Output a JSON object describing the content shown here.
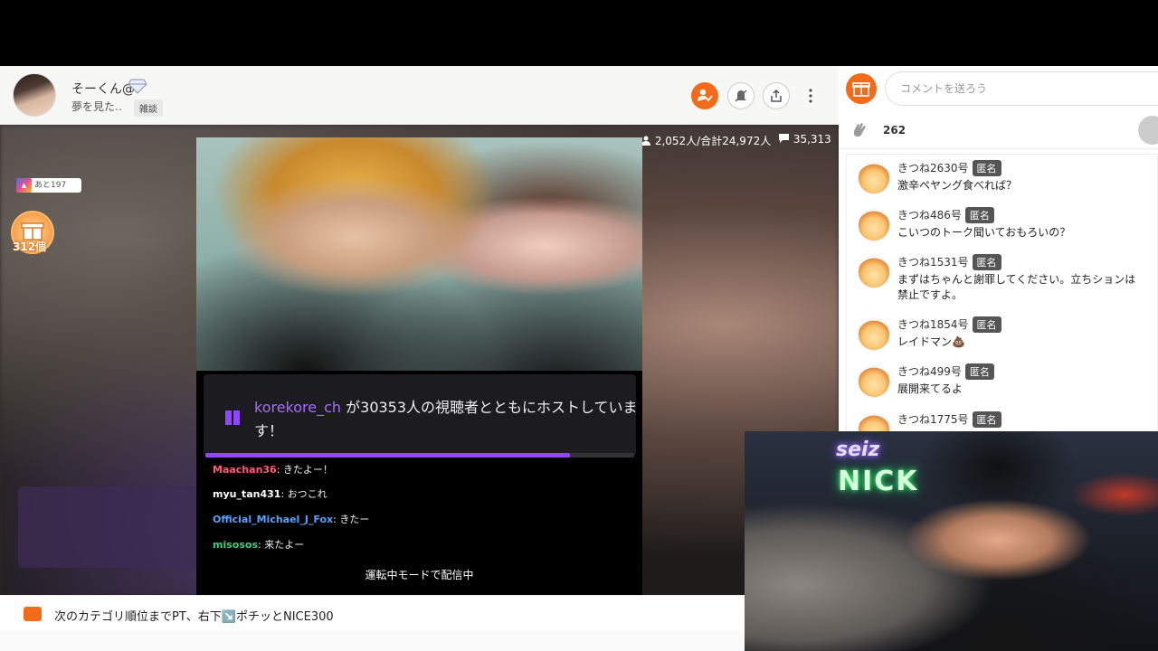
{
  "streamer": {
    "name": "そーくん@",
    "subtitle": "夢を見た‥",
    "category": "雑談"
  },
  "stats": {
    "viewers": "2,052人/合計24,972人",
    "comments": "35,313"
  },
  "rank": {
    "badge_icon": "あと",
    "remaining": "あと197"
  },
  "gifts": {
    "count": "312個"
  },
  "inner_stream": {
    "host_user": "korekore_ch",
    "host_message": "が30353人の視聴者とともにホストしています！",
    "chat": [
      {
        "user": "Maachan36",
        "text": "きたよー！",
        "color": "#ff5a7a"
      },
      {
        "user": "myu_tan431",
        "text": "おつこれ",
        "color": "#ffffff"
      },
      {
        "user": "Official_Michael_J_Fox",
        "text": "きたー",
        "color": "#5aa0ff"
      },
      {
        "user": "misosos",
        "text": "来たよー",
        "color": "#3ed07a"
      }
    ],
    "driving_mode": "運転中モードで配信中"
  },
  "ticker": {
    "text": "次のカテゴリ順位までPT、右下↘️ポチッとNICE300"
  },
  "side": {
    "comment_placeholder": "コメントを送ろう",
    "clap_count": "262",
    "comments": [
      {
        "name": "きつね2630号",
        "badge": "匿名",
        "text": "激辛ペヤング食べれば？"
      },
      {
        "name": "きつね486号",
        "badge": "匿名",
        "text": "こいつのトーク聞いておもろいの？"
      },
      {
        "name": "きつね1531号",
        "badge": "匿名",
        "text": "まずはちゃんと謝罪してください。立ちションは禁止ですよ。"
      },
      {
        "name": "きつね1854号",
        "badge": "匿名",
        "text": "レイドマン💩"
      },
      {
        "name": "きつね499号",
        "badge": "匿名",
        "text": "展開来てるよ"
      },
      {
        "name": "きつね1775号",
        "badge": "匿名",
        "text": ""
      }
    ]
  },
  "facecam": {
    "sign1": "seiz",
    "sign2": "NICK"
  },
  "colors": {
    "accent": "#f36a1b",
    "twitch_purple": "#9147ff"
  }
}
